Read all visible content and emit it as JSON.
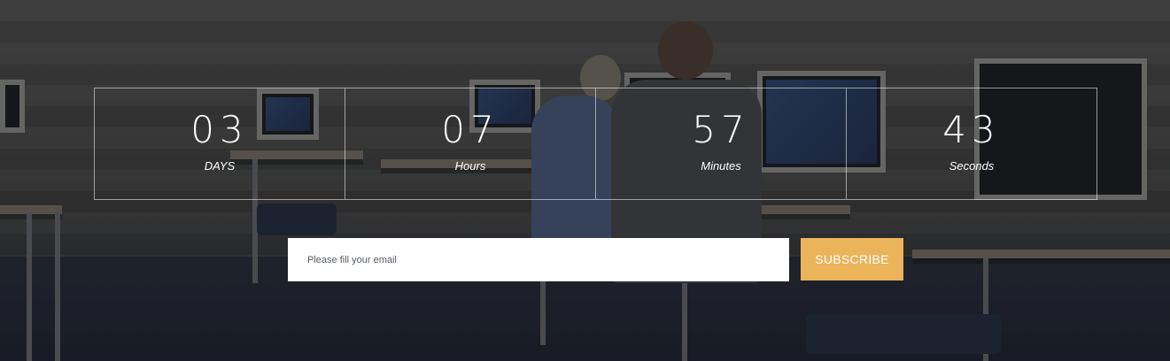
{
  "countdown": {
    "days": {
      "value": "03",
      "label": "DAYS"
    },
    "hours": {
      "value": "07",
      "label": "Hours"
    },
    "minutes": {
      "value": "57",
      "label": "Minutes"
    },
    "seconds": {
      "value": "43",
      "label": "Seconds"
    }
  },
  "subscribe": {
    "email_placeholder": "Please fill your email",
    "button_label": "SUBSCRIBE"
  },
  "colors": {
    "accent": "#ebb35a",
    "overlay": "#121418"
  }
}
